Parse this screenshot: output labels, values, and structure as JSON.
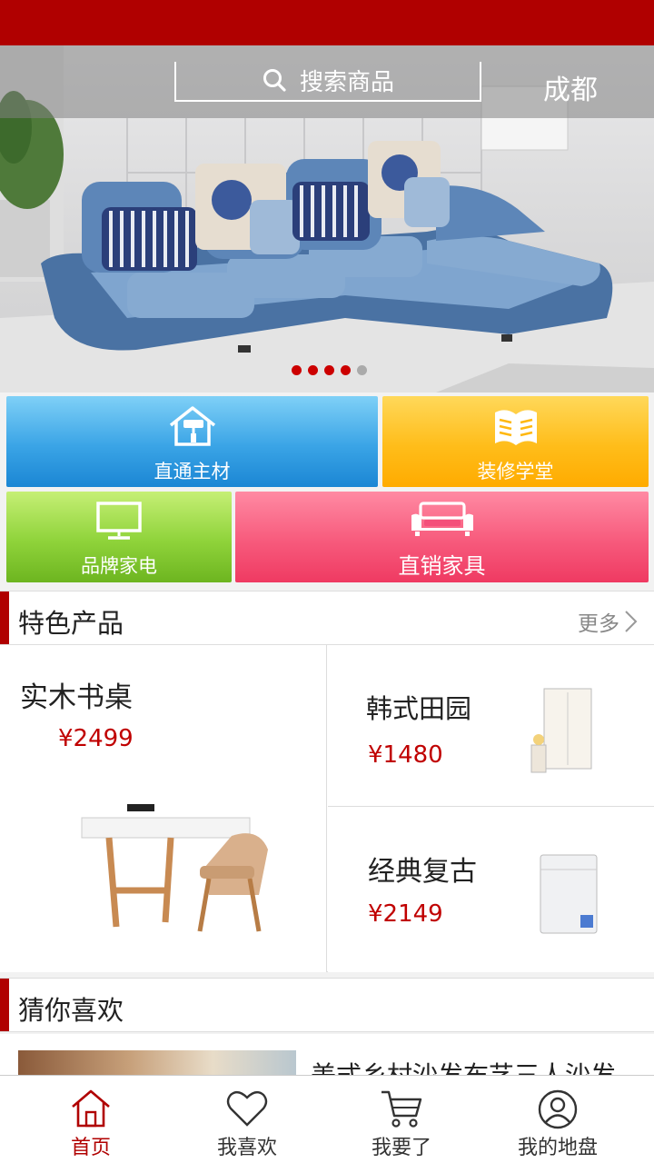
{
  "search": {
    "placeholder": "搜索商品",
    "icon": "search-icon"
  },
  "location": {
    "city": "成都"
  },
  "banner": {
    "slides_total": 5,
    "active_slide": 4
  },
  "categories": [
    {
      "label": "直通主材",
      "icon": "house-roller-icon",
      "color": "#2a97e0"
    },
    {
      "label": "装修学堂",
      "icon": "open-book-icon",
      "color": "#ffb811"
    },
    {
      "label": "品牌家电",
      "icon": "tv-icon",
      "color": "#80c82e"
    },
    {
      "label": "直销家具",
      "icon": "sofa-icon",
      "color": "#f4507a"
    }
  ],
  "featured": {
    "title": "特色产品",
    "more_label": "更多",
    "products": [
      {
        "name": "实木书桌",
        "price": "¥2499",
        "icon": "desk-chair-image"
      },
      {
        "name": "韩式田园",
        "price": "¥1480",
        "icon": "wardrobe-image"
      },
      {
        "name": "经典复古",
        "price": "¥2149",
        "icon": "fridge-image"
      }
    ]
  },
  "guess": {
    "title": "猜你喜欢",
    "items": [
      {
        "title": "美式乡村沙发布艺三人沙发"
      }
    ]
  },
  "nav": [
    {
      "label": "首页",
      "icon": "home-icon",
      "active": true
    },
    {
      "label": "我喜欢",
      "icon": "heart-icon",
      "active": false
    },
    {
      "label": "我要了",
      "icon": "cart-icon",
      "active": false
    },
    {
      "label": "我的地盘",
      "icon": "user-icon",
      "active": false
    }
  ],
  "colors": {
    "brand": "#b00000",
    "price": "#c00000"
  }
}
